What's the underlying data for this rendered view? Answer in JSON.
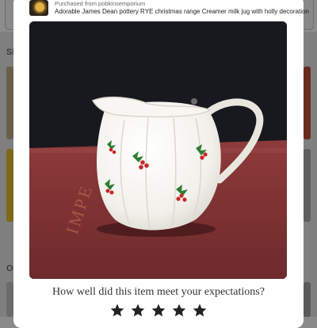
{
  "header": {
    "purchased_from": "Purchased from pobkinsemporium",
    "item_title": "Adorable James Dean pottery RYE christmas range Creamer milk jug with holly decoration"
  },
  "background": {
    "section_label_1": "Si",
    "section_label_2": "O"
  },
  "photo": {
    "book_spine_text": "IMPE",
    "icon": "photo-of-holly-creamer-jug"
  },
  "review": {
    "question": "How well did this item meet your expectations?",
    "star_count": 5,
    "rating_selected": 0
  },
  "colors": {
    "modal_bg": "#ffffff",
    "overlay": "#7f7f7f",
    "star": "#222222",
    "holly_green": "#2e7d32",
    "berry_red": "#c62828"
  }
}
